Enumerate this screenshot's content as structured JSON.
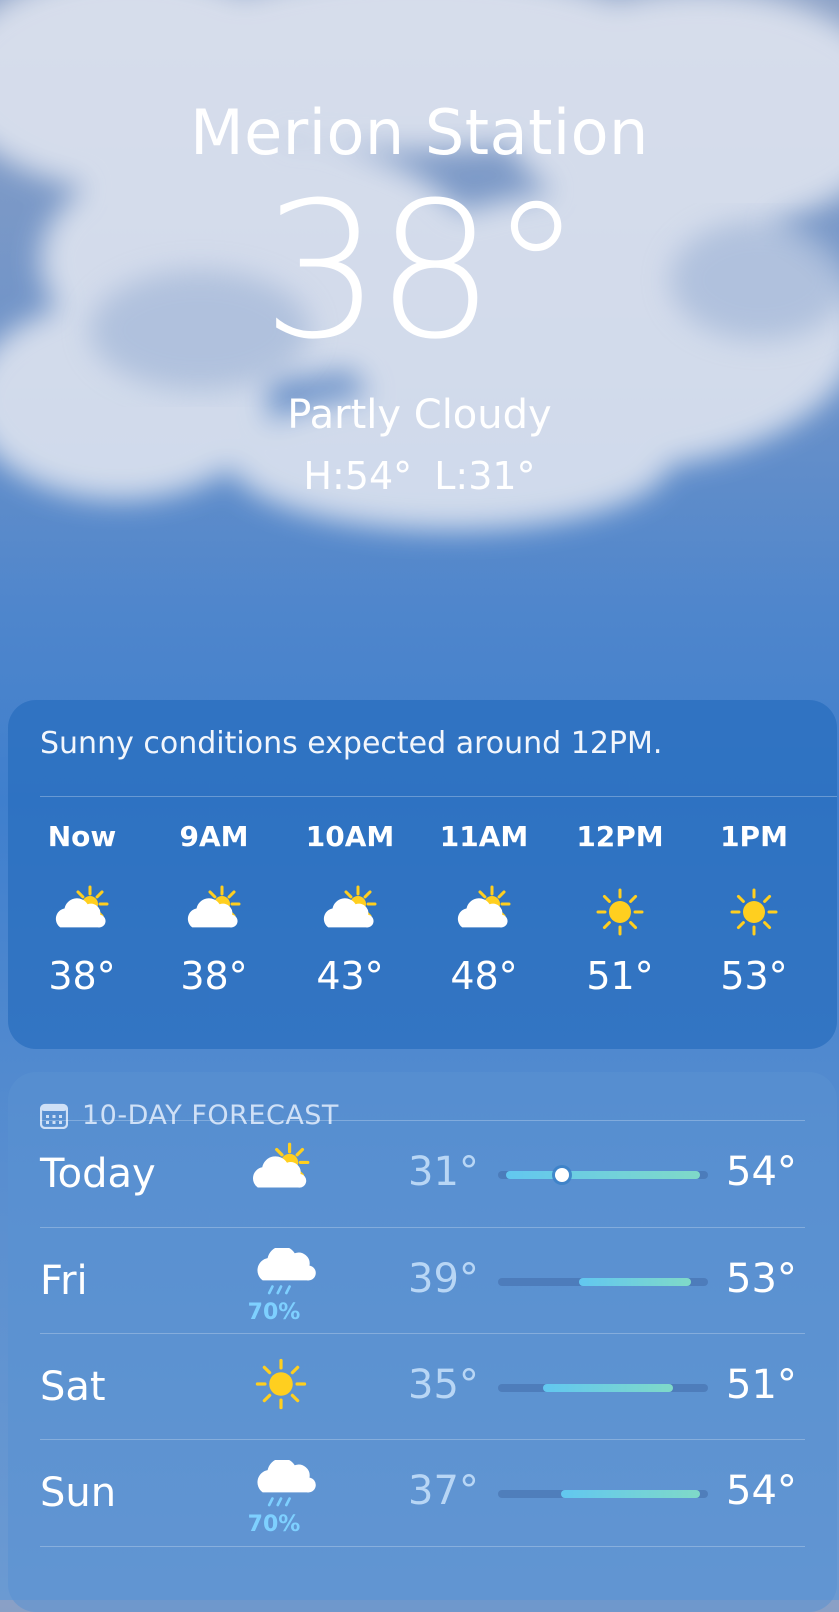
{
  "location": {
    "city": "Merion Station",
    "temperature": "38°",
    "condition": "Partly Cloudy",
    "high_low": "H:54°  L:31°"
  },
  "hourly": {
    "summary": "Sunny conditions expected around 12PM.",
    "items": [
      {
        "label": "Now",
        "icon": "partly-cloudy-icon",
        "temp": "38°"
      },
      {
        "label": "9AM",
        "icon": "partly-cloudy-icon",
        "temp": "38°"
      },
      {
        "label": "10AM",
        "icon": "partly-cloudy-icon",
        "temp": "43°"
      },
      {
        "label": "11AM",
        "icon": "partly-cloudy-icon",
        "temp": "48°"
      },
      {
        "label": "12PM",
        "icon": "sun-icon",
        "temp": "51°"
      },
      {
        "label": "1PM",
        "icon": "sun-icon",
        "temp": "53°"
      }
    ]
  },
  "daily": {
    "header": "10-DAY FORECAST",
    "header_icon": "calendar-icon",
    "range_scale_min": 31,
    "range_scale_max": 54,
    "days": [
      {
        "day": "Today",
        "icon": "partly-cloudy-icon",
        "precip": "",
        "low": "31°",
        "high": "54°",
        "low_value": 31,
        "high_value": 54,
        "current_value": 38
      },
      {
        "day": "Fri",
        "icon": "rain-icon",
        "precip": "70%",
        "low": "39°",
        "high": "53°",
        "low_value": 39,
        "high_value": 53
      },
      {
        "day": "Sat",
        "icon": "sun-icon",
        "precip": "",
        "low": "35°",
        "high": "51°",
        "low_value": 35,
        "high_value": 51
      },
      {
        "day": "Sun",
        "icon": "rain-icon",
        "precip": "70%",
        "low": "37°",
        "high": "54°",
        "low_value": 37,
        "high_value": 54
      }
    ]
  },
  "colors": {
    "sun": "#ffcf1f",
    "cloud": "#ffffff",
    "precip": "#7ed0ff",
    "bar_cool": "#62c7f0",
    "bar_warm": "#7fd9c8"
  }
}
